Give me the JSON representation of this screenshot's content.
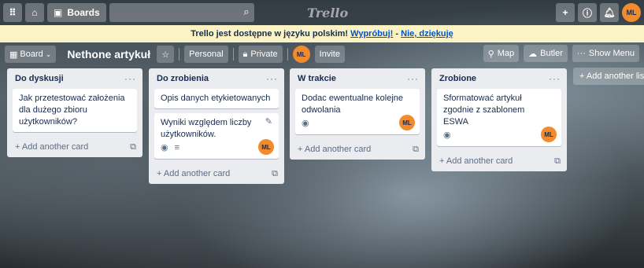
{
  "topbar": {
    "apps_icon": "grid-icon",
    "home_icon": "home-icon",
    "boards_label": "Boards",
    "search_icon": "search-icon",
    "logo": "Trello",
    "add_icon": "plus-icon",
    "info_icon": "info-icon",
    "bell_icon": "bell-icon",
    "avatar": "ML"
  },
  "banner": {
    "text": "Trello jest dostępne w języku polskim!",
    "switch_link": "Wypróbuj!",
    "separator": "-",
    "dismiss_link": "Nie, dziękuję"
  },
  "board_bar": {
    "view_label": "Board",
    "title": "Nethone artykuł",
    "team_label": "Personal",
    "visibility_label": "Private",
    "member_avatar": "ML",
    "invite_label": "Invite",
    "map_label": "Map",
    "butler_label": "Butler",
    "menu_label": "Show Menu"
  },
  "lists": [
    {
      "title": "Do dyskusji",
      "cards": [
        {
          "text": "Jak przetestować założenia dla dużego zbioru użytkowników?"
        }
      ],
      "add_label": "+ Add another card"
    },
    {
      "title": "Do zrobienia",
      "cards": [
        {
          "text": "Opis danych etykietowanych"
        },
        {
          "text": "Wyniki względem liczby użytkowników.",
          "avatar": "ML"
        }
      ],
      "add_label": "+ Add another card"
    },
    {
      "title": "W trakcie",
      "cards": [
        {
          "text": "Dodac ewentualne kolejne odwolania",
          "avatar": "ML"
        }
      ],
      "add_label": "+ Add another card"
    },
    {
      "title": "Zrobione",
      "cards": [
        {
          "text": "Sformatować artykuł zgodnie z szablonem ESWA",
          "avatar": "ML"
        }
      ],
      "add_label": "+ Add another card"
    }
  ],
  "add_list_label": "+ Add another list",
  "list_menu_glyph": "···"
}
